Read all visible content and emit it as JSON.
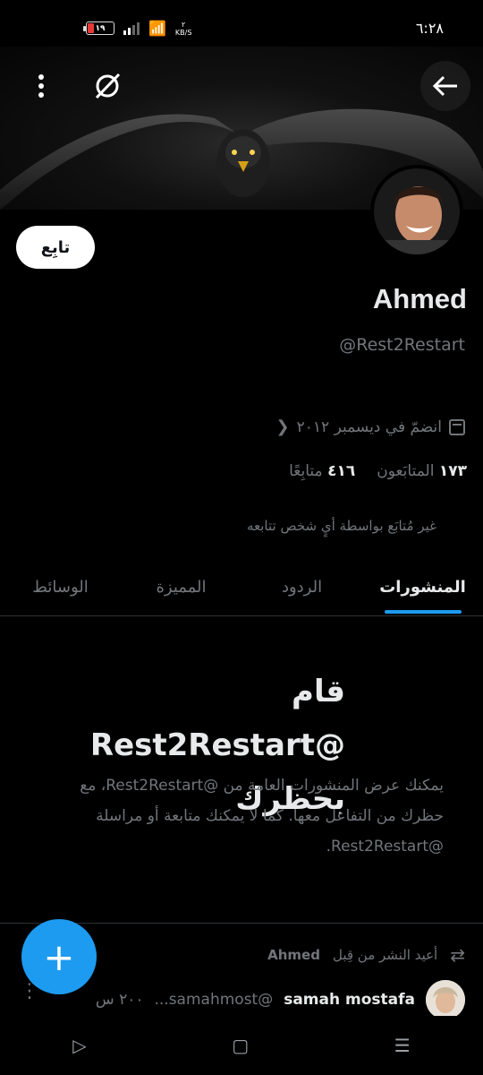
{
  "status_bar": {
    "time": "٦:٢٨",
    "battery_level": "١٩",
    "network_speed_value": "٢",
    "network_speed_unit": "KB/S"
  },
  "header": {
    "back_icon": "arrow-left-icon",
    "mute_icon": "eye-off-icon",
    "more_icon": "more-vertical-icon"
  },
  "profile": {
    "follow_label": "تابِع",
    "name": "Ahmed",
    "handle": "@Rest2Restart",
    "joined": "انضمّ في ديسمبر ٢٠١٢",
    "followers_count": "١٧٣",
    "followers_label": "المتابَعون",
    "following_count": "٤١٦",
    "following_label": "متابِعًا",
    "not_followed_note": "غير مُتابَع بواسطة أيٍ شخص تتابعه"
  },
  "tabs": [
    {
      "label": "المنشورات",
      "active": true
    },
    {
      "label": "الردود",
      "active": false
    },
    {
      "label": "المميزة",
      "active": false
    },
    {
      "label": "الوسائط",
      "active": false
    }
  ],
  "blocked": {
    "title": "قام @Rest2Restart بحظرك",
    "description": "يمكنك عرض المنشورات العامة من @Rest2Restart، مع حظرك من التفاعل معها. كما لا يمكنك متابعة أو مراسلة @Rest2Restart."
  },
  "feed": {
    "repost_prefix": "أعيد النشر من قِبل",
    "repost_by": "Ahmed",
    "tweet_author": "samah mostafa",
    "tweet_handle": "@samahmost...",
    "tweet_time": "٢٠٠ س"
  },
  "fab_label": "+",
  "colors": {
    "accent": "#1d9bf0",
    "background": "#000000",
    "muted_text": "#71767b"
  }
}
